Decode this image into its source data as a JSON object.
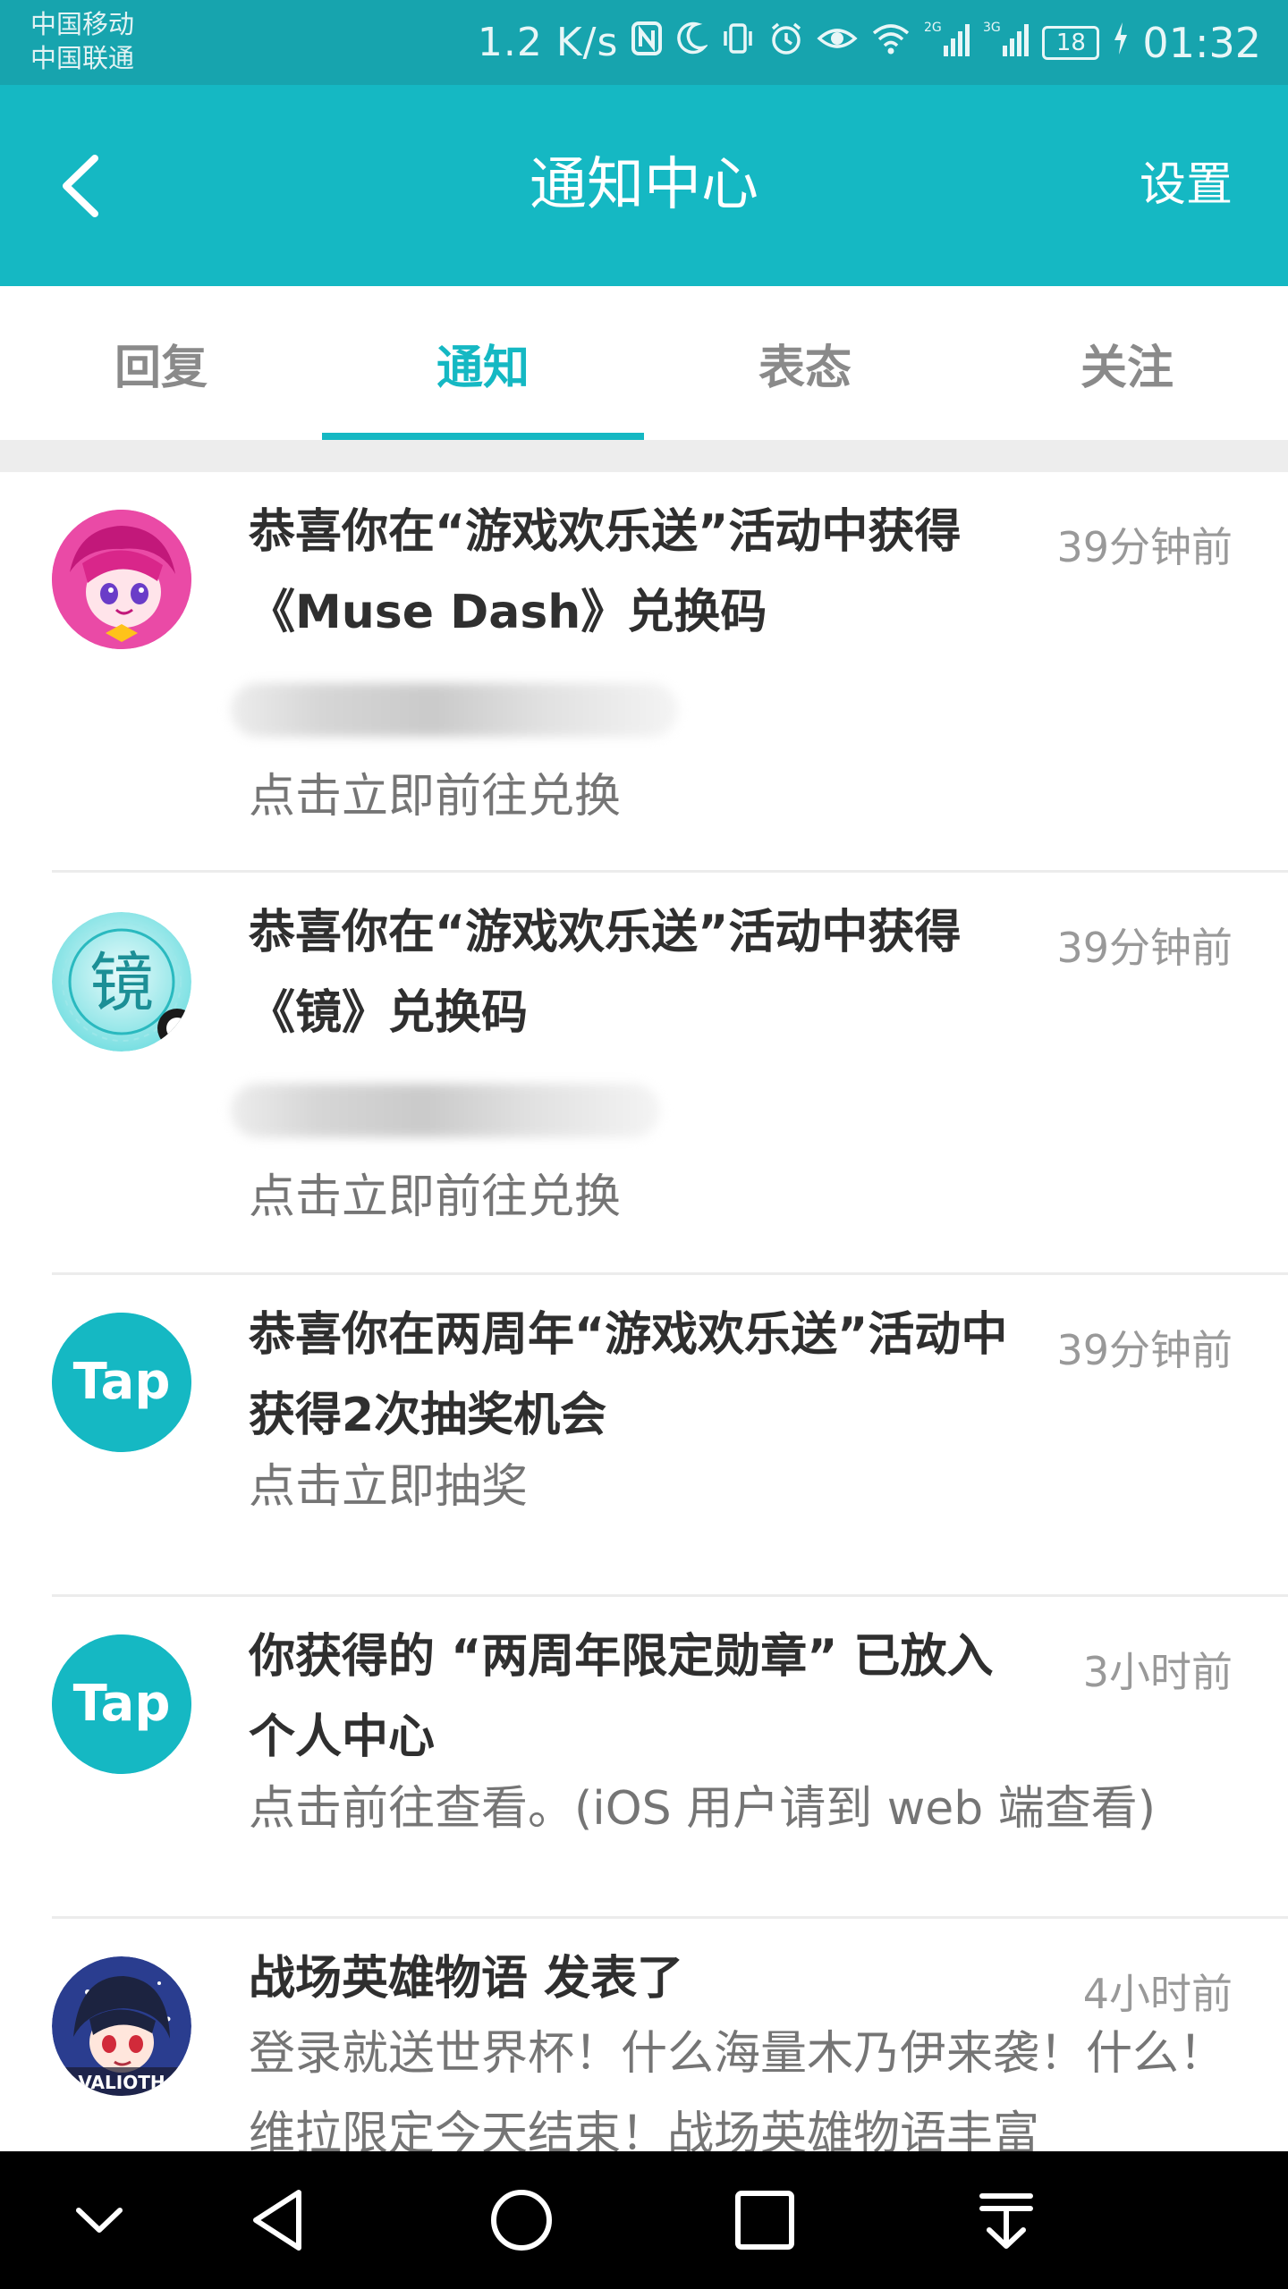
{
  "status_bar": {
    "carrier_1": "中国移动",
    "carrier_2": "中国联通",
    "net_speed": "1.2 K/s",
    "battery": "18",
    "time": "01:32",
    "network_1": "2G",
    "network_2": "3G"
  },
  "header": {
    "title": "通知中心",
    "settings_label": "设置",
    "back_icon": "chevron-left-icon",
    "background_color": "#15b8c3"
  },
  "tabs": [
    {
      "label": "回复",
      "active": false
    },
    {
      "label": "通知",
      "active": true
    },
    {
      "label": "表态",
      "active": false
    },
    {
      "label": "关注",
      "active": false
    }
  ],
  "notifications": [
    {
      "title": "恭喜你在“游戏欢乐送”活动中获得《Muse Dash》兑换码",
      "time": "39分钟前",
      "subtitle": "点击立即前往兑换",
      "avatar": "muse-dash-character-avatar",
      "code_blurred": true
    },
    {
      "title": "恭喜你在“游戏欢乐送”活动中获得《镜》兑换码",
      "time": "39分钟前",
      "subtitle": "点击立即前往兑换",
      "avatar": "jing-game-avatar",
      "avatar_glyph": "镜",
      "code_blurred": true
    },
    {
      "title": "恭喜你在两周年“游戏欢乐送”活动中获得2次抽奖机会",
      "time": "39分钟前",
      "subtitle": "点击立即抽奖",
      "avatar": "taptap-logo",
      "avatar_text": "Tap"
    },
    {
      "title": "你获得的 “两周年限定勋章” 已放入个人中心",
      "time": "3小时前",
      "subtitle": "点击前往查看。(iOS 用户请到 web 端查看)",
      "avatar": "taptap-logo",
      "avatar_text": "Tap"
    },
    {
      "title": "战场英雄物语 发表了",
      "time": "4小时前",
      "subtitle": "登录就送世界杯！什么海量木乃伊来袭！什么！维拉限定今天结束！战场英雄物语丰富",
      "avatar": "battlefield-heroes-character-avatar",
      "avatar_text": "VALIOTH"
    }
  ],
  "nav_bar": {
    "icons": [
      "chevron-down-icon",
      "back-triangle-icon",
      "home-circle-icon",
      "recents-square-icon",
      "pull-down-icon"
    ]
  }
}
